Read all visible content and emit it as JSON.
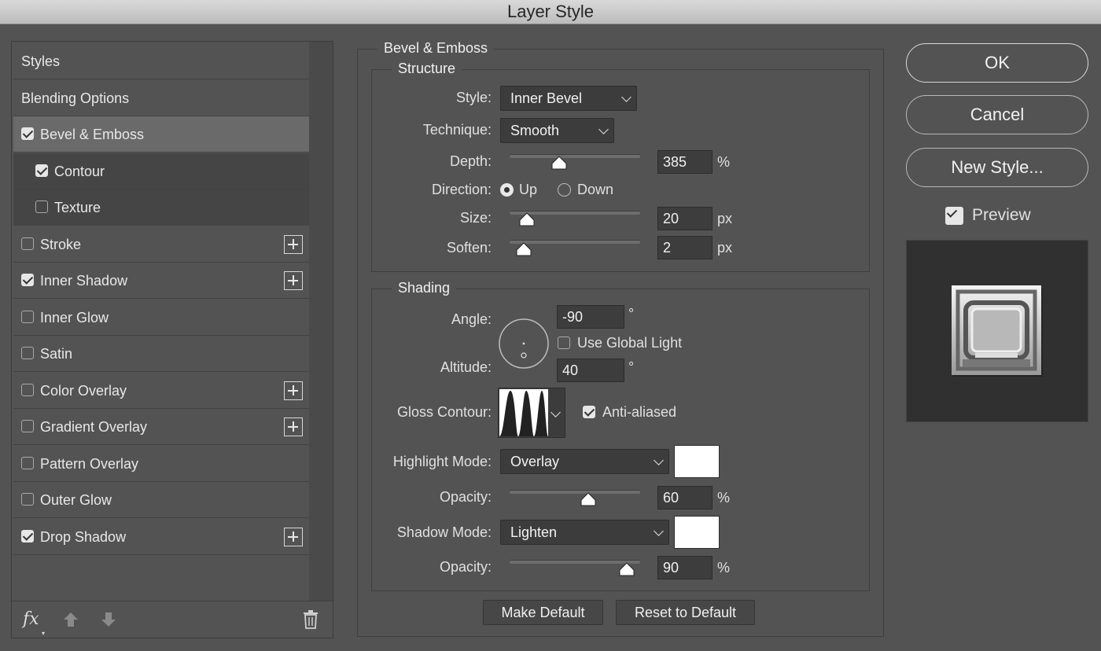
{
  "window": {
    "title": "Layer Style"
  },
  "sidebar": {
    "items": [
      {
        "label": "Styles",
        "checkbox": null,
        "selected": false,
        "sub": false,
        "plus": false
      },
      {
        "label": "Blending Options",
        "checkbox": null,
        "selected": false,
        "sub": false,
        "plus": false
      },
      {
        "label": "Bevel & Emboss",
        "checkbox": true,
        "selected": true,
        "sub": false,
        "plus": false
      },
      {
        "label": "Contour",
        "checkbox": true,
        "selected": false,
        "sub": true,
        "plus": false
      },
      {
        "label": "Texture",
        "checkbox": false,
        "selected": false,
        "sub": true,
        "plus": false
      },
      {
        "label": "Stroke",
        "checkbox": false,
        "selected": false,
        "sub": false,
        "plus": true
      },
      {
        "label": "Inner Shadow",
        "checkbox": true,
        "selected": false,
        "sub": false,
        "plus": true
      },
      {
        "label": "Inner Glow",
        "checkbox": false,
        "selected": false,
        "sub": false,
        "plus": false
      },
      {
        "label": "Satin",
        "checkbox": false,
        "selected": false,
        "sub": false,
        "plus": false
      },
      {
        "label": "Color Overlay",
        "checkbox": false,
        "selected": false,
        "sub": false,
        "plus": true
      },
      {
        "label": "Gradient Overlay",
        "checkbox": false,
        "selected": false,
        "sub": false,
        "plus": true
      },
      {
        "label": "Pattern Overlay",
        "checkbox": false,
        "selected": false,
        "sub": false,
        "plus": false
      },
      {
        "label": "Outer Glow",
        "checkbox": false,
        "selected": false,
        "sub": false,
        "plus": false
      },
      {
        "label": "Drop Shadow",
        "checkbox": true,
        "selected": false,
        "sub": false,
        "plus": true
      }
    ],
    "footer": {
      "fx_label": "fx",
      "fx_dropdown_dot": "▾"
    }
  },
  "bevel": {
    "section_title": "Bevel & Emboss",
    "structure": {
      "title": "Structure",
      "style_label": "Style:",
      "style_value": "Inner Bevel",
      "technique_label": "Technique:",
      "technique_value": "Smooth",
      "depth_label": "Depth:",
      "depth_value": "385",
      "depth_unit": "%",
      "depth_slider": 0.38,
      "direction_label": "Direction:",
      "dir_up": "Up",
      "dir_down": "Down",
      "direction": "up",
      "size_label": "Size:",
      "size_value": "20",
      "size_unit": "px",
      "size_slider": 0.13,
      "soften_label": "Soften:",
      "soften_value": "2",
      "soften_unit": "px",
      "soften_slider": 0.11
    },
    "shading": {
      "title": "Shading",
      "angle_label": "Angle:",
      "angle_value": "-90",
      "angle_unit": "°",
      "global_light_label": "Use Global Light",
      "global_light": false,
      "altitude_label": "Altitude:",
      "altitude_value": "40",
      "altitude_unit": "°",
      "gloss_label": "Gloss Contour:",
      "anti_aliased_label": "Anti-aliased",
      "anti_aliased": true,
      "highlight_label": "Highlight Mode:",
      "highlight_value": "Overlay",
      "highlight_color": "#ffffff",
      "highlight_opacity_label": "Opacity:",
      "highlight_opacity": "60",
      "highlight_opacity_unit": "%",
      "highlight_opacity_slider": 0.6,
      "shadow_label": "Shadow Mode:",
      "shadow_value": "Lighten",
      "shadow_color": "#ffffff",
      "shadow_opacity_label": "Opacity:",
      "shadow_opacity": "90",
      "shadow_opacity_unit": "%",
      "shadow_opacity_slider": 0.9
    },
    "make_default": "Make Default",
    "reset_default": "Reset to Default"
  },
  "actions": {
    "ok": "OK",
    "cancel": "Cancel",
    "new_style": "New Style...",
    "preview_label": "Preview",
    "preview": true
  }
}
